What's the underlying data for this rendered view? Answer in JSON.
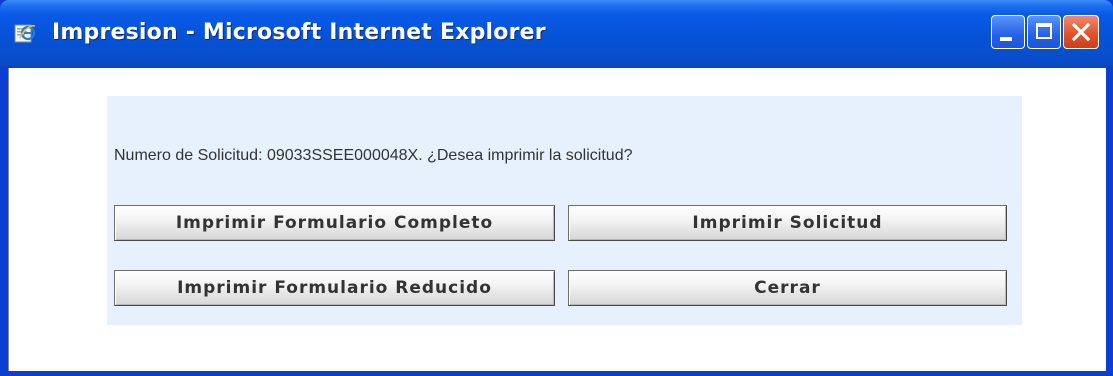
{
  "window": {
    "title": "Impresion - Microsoft Internet Explorer",
    "icon": "internet-explorer-icon",
    "controls": {
      "minimize": "minimize-icon",
      "maximize": "maximize-icon",
      "close": "close-icon"
    }
  },
  "dialog": {
    "message": "Numero de Solicitud: 09033SSEE000048X. ¿Desea imprimir la solicitud?",
    "buttons": {
      "print_full_form": "Imprimir Formulario Completo",
      "print_request": "Imprimir Solicitud",
      "print_reduced_form": "Imprimir Formulario Reducido",
      "close": "Cerrar"
    }
  },
  "colors": {
    "titlebar": "#0553d8",
    "panel_background": "#e6f1fd",
    "close_button": "#e2532a"
  }
}
